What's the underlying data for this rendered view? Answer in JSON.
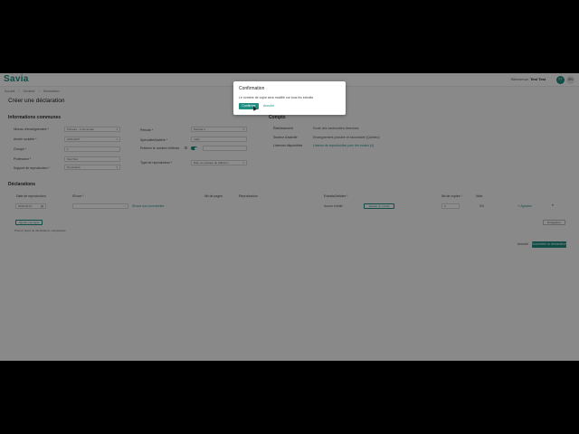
{
  "app": {
    "logo": "Savia",
    "welcome_prefix": "Bienvenue,",
    "user_name": "Test Test",
    "user_initials": "TT",
    "lang": "EN"
  },
  "breadcrumb": [
    "Accueil",
    "Déclarer",
    "Déclaration"
  ],
  "page_title": "Créer une déclaration",
  "info": {
    "title": "Informations communes",
    "niveau_label": "Niveau d'enseignement *",
    "niveau_value": "Primaire - 1 ère année",
    "annee_label": "Année scolaire *",
    "annee_value": "2026-2027",
    "groupe_label": "Groupe *",
    "groupe_value": "1",
    "prof_label": "Professeur *",
    "prof_value": "Test Test",
    "support_label": "Support de reproduction *",
    "support_value": "Numérique",
    "periode_label": "Période *",
    "periode_value": "Période 1",
    "specialite_label": "Spécialité/Matière *",
    "specialite_value": "math",
    "prelever_label": "Prélever le nombre d'élèves",
    "type_label": "Type de reproduction *",
    "type_value": "Rien ou presque de réfléxion"
  },
  "compte": {
    "title": "Compte",
    "etab_label": "Établissement",
    "etab_value": "Ecole des cantonniers-Varennes",
    "secteur_label": "Secteur d'activité",
    "secteur_value": "Enseignement primaire et secondaire (Québec)",
    "licences_label": "Licences disponibles",
    "licences_value": "Licence de reproduction pour les écoles (4)"
  },
  "declarations": {
    "title": "Déclarations",
    "columns": [
      "Date de reproduction",
      "Œuvre *",
      "Nb de pages",
      "Reproduction",
      "Extraits/Articles *",
      "Nb de copies *",
      "Note"
    ],
    "row": {
      "date": "2026-06-10",
      "oeuvre_link": "Œuvre non-inventoriée",
      "extraits": "Aucun extrait",
      "extraits_button": "Ajouter un extrait",
      "copies": "0",
      "note": "0/0",
      "add_link": "+ Ajouter"
    },
    "add_button": "Ajouter une ligne",
    "hint": "Prévoir l'ajout de déclarations manquantes",
    "save_draft": "Enregistrer",
    "cancel": "Annuler",
    "submit": "Soumettre la déclaration"
  },
  "modal": {
    "title": "Confirmation",
    "body": "Le nombre de copie sera modifié sur tous les extraits",
    "confirm": "Confirmer",
    "cancel": "Annuler"
  }
}
